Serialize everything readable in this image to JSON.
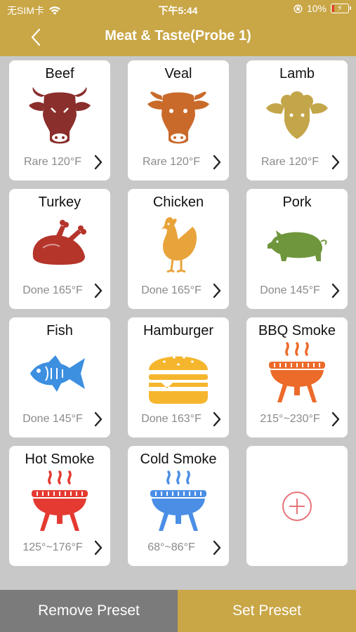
{
  "status_bar": {
    "carrier": "无SIM卡",
    "time": "下午5:44",
    "battery": "10%"
  },
  "header": {
    "title": "Meat & Taste(Probe 1)"
  },
  "colors": {
    "accent": "#c9a646",
    "remove_button": "#7b7b7b",
    "add_button": "#e9747b"
  },
  "presets": [
    {
      "name": "Beef",
      "temp": "Rare 120°F",
      "icon": "cow-head-icon",
      "color": "#8a2f2c"
    },
    {
      "name": "Veal",
      "temp": "Rare 120°F",
      "icon": "calf-head-icon",
      "color": "#c96a2b"
    },
    {
      "name": "Lamb",
      "temp": "Rare 120°F",
      "icon": "lamb-head-icon",
      "color": "#c3a64a"
    },
    {
      "name": "Turkey",
      "temp": "Done 165°F",
      "icon": "roast-turkey-icon",
      "color": "#b5352b"
    },
    {
      "name": "Chicken",
      "temp": "Done 165°F",
      "icon": "chicken-icon",
      "color": "#e8a33a"
    },
    {
      "name": "Pork",
      "temp": "Done 145°F",
      "icon": "pig-icon",
      "color": "#6f963c"
    },
    {
      "name": "Fish",
      "temp": "Done 145°F",
      "icon": "fish-icon",
      "color": "#3d8fe0"
    },
    {
      "name": "Hamburger",
      "temp": "Done 163°F",
      "icon": "hamburger-icon",
      "color": "#f5b62d"
    },
    {
      "name": "BBQ Smoke",
      "temp": "215°~230°F",
      "icon": "grill-icon",
      "color": "#ec6a2a"
    },
    {
      "name": "Hot Smoke",
      "temp": "125°~176°F",
      "icon": "grill-icon",
      "color": "#e43a31"
    },
    {
      "name": "Cold Smoke",
      "temp": "68°~86°F",
      "icon": "grill-icon",
      "color": "#4a8ee6"
    }
  ],
  "add_card": {
    "icon": "add-circle-icon"
  },
  "footer": {
    "remove_label": "Remove Preset",
    "set_label": "Set Preset"
  }
}
